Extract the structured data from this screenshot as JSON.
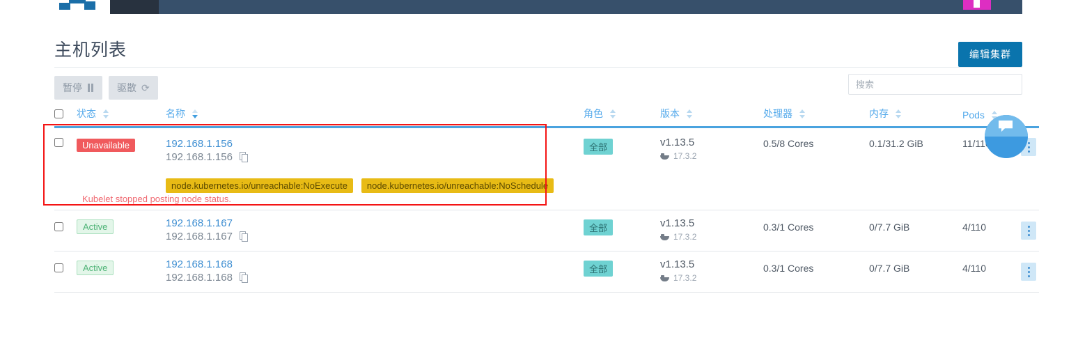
{
  "navbar": {
    "logo_name": "rancher-logo",
    "accent_color": "#dd2ec2",
    "bg_color": "#37506b"
  },
  "header": {
    "title": "主机列表",
    "edit_cluster_label": "编辑集群"
  },
  "toolbar": {
    "pause_label": "暂停",
    "drain_label": "驱散",
    "search_placeholder": "搜索",
    "search_value": ""
  },
  "table": {
    "columns": [
      {
        "key": "check",
        "label": ""
      },
      {
        "key": "status",
        "label": "状态",
        "sorted": false
      },
      {
        "key": "name",
        "label": "名称",
        "sorted": true
      },
      {
        "key": "role",
        "label": "角色",
        "sorted": false
      },
      {
        "key": "version",
        "label": "版本",
        "sorted": false
      },
      {
        "key": "cpu",
        "label": "处理器",
        "sorted": false
      },
      {
        "key": "memory",
        "label": "内存",
        "sorted": false
      },
      {
        "key": "pods",
        "label": "Pods",
        "sorted": false
      }
    ],
    "rows": [
      {
        "status": "Unavailable",
        "status_kind": "unavailable",
        "name": "192.168.1.156",
        "ip": "192.168.1.156",
        "role": "全部",
        "version": "v1.13.5",
        "docker_version": "17.3.2",
        "cpu": "0.5/8 Cores",
        "memory": "0.1/31.2 GiB",
        "pods": "11/110",
        "taints": [
          "node.kubernetes.io/unreachable:NoExecute",
          "node.kubernetes.io/unreachable:NoSchedule"
        ],
        "error": "Kubelet stopped posting node status."
      },
      {
        "status": "Active",
        "status_kind": "active",
        "name": "192.168.1.167",
        "ip": "192.168.1.167",
        "role": "全部",
        "version": "v1.13.5",
        "docker_version": "17.3.2",
        "cpu": "0.3/1 Cores",
        "memory": "0/7.7 GiB",
        "pods": "4/110",
        "taints": [],
        "error": ""
      },
      {
        "status": "Active",
        "status_kind": "active",
        "name": "192.168.1.168",
        "ip": "192.168.1.168",
        "role": "全部",
        "version": "v1.13.5",
        "docker_version": "17.3.2",
        "cpu": "0.3/1 Cores",
        "memory": "0/7.7 GiB",
        "pods": "4/110",
        "taints": [],
        "error": ""
      }
    ]
  },
  "annotation": {
    "color": "#f41414"
  },
  "help_widget": {
    "name": "help-chat-bubble",
    "color": "#3d9ae0"
  },
  "colors": {
    "accent_blue": "#4aa3df",
    "link_blue": "#3f8fd2",
    "danger_red": "#f05a5d",
    "success_green": "#4fb477",
    "taint_yellow": "#e8bb15",
    "role_teal": "#6fd2d2",
    "primary_button": "#0a74ad"
  }
}
